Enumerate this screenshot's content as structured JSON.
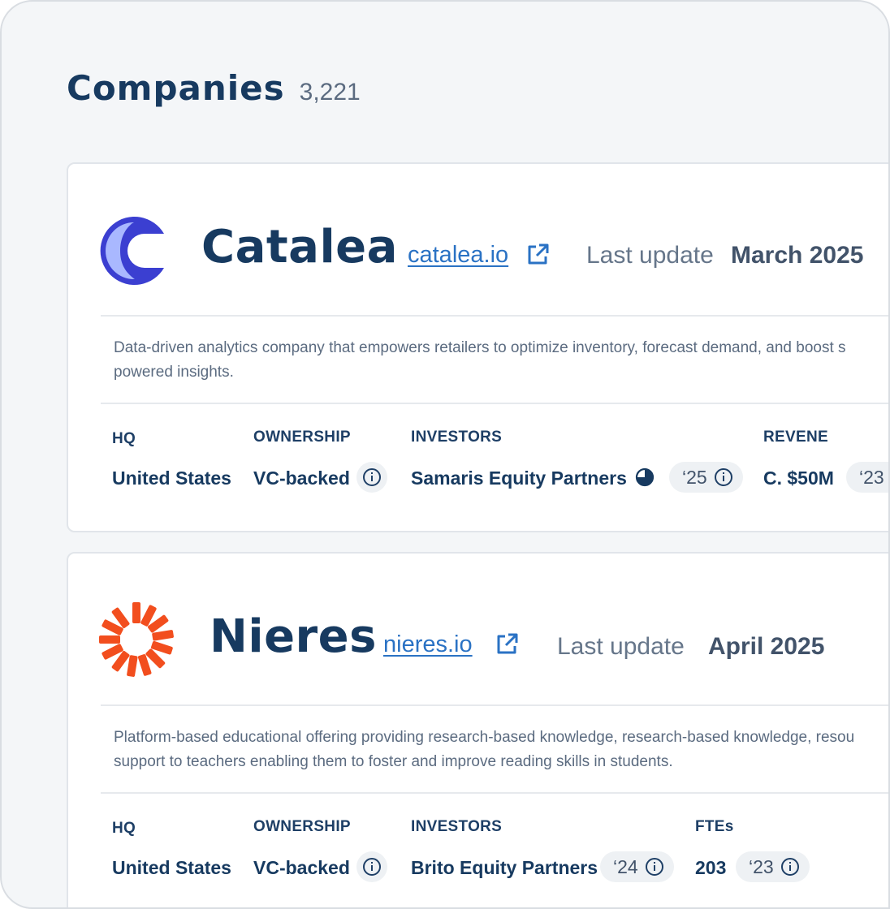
{
  "page": {
    "title": "Companies",
    "count": "3,221"
  },
  "companies": [
    {
      "name": "Catalea",
      "website": "catalea.io",
      "last_update_label": "Last update",
      "last_update_value": "March 2025",
      "description": "Data-driven analytics company that empowers retailers to optimize inventory, forecast demand, and boost s\npowered insights.",
      "logo_icon": "catalea-c-logo",
      "fields": {
        "hq_label": "HQ",
        "hq_value": "United States",
        "ownership_label": "OWNERSHIP",
        "ownership_value": "VC-backed",
        "investors_label": "INVESTORS",
        "investors_value": "Samaris Equity Partners",
        "investors_year": "‘25",
        "fourth_label": "REVENE",
        "fourth_value": "C. $50M",
        "fourth_year": "‘23"
      }
    },
    {
      "name": "Nieres",
      "website": "nieres.io",
      "last_update_label": "Last update",
      "last_update_value": "April 2025",
      "description": "Platform-based educational offering providing research-based knowledge, research-based knowledge, resou\nsupport to teachers enabling them to foster and improve reading skills in students.",
      "logo_icon": "nieres-sunburst-logo",
      "fields": {
        "hq_label": "HQ",
        "hq_value": "United States",
        "ownership_label": "OWNERSHIP",
        "ownership_value": "VC-backed",
        "investors_label": "INVESTORS",
        "investors_value": "Brito Equity Partners",
        "investors_year": "‘24",
        "fourth_label": "FTEs",
        "fourth_value": "203",
        "fourth_year": "‘23"
      }
    }
  ],
  "colors": {
    "brand_navy": "#173a60",
    "link_blue": "#2a72c4",
    "catalea_blue": "#3b3fd1",
    "catalea_light": "#a9b8ff",
    "nieres_orange": "#f24e1e"
  }
}
